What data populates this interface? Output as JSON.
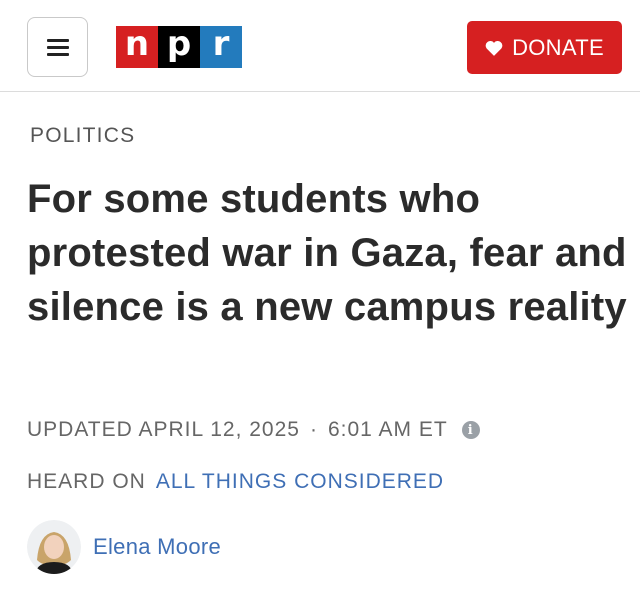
{
  "header": {
    "logo": [
      "n",
      "p",
      "r"
    ],
    "donate_label": "DONATE"
  },
  "article": {
    "section": "POLITICS",
    "headline": "For some students who protested war in Gaza, fear and silence is a new campus reality",
    "updated_label": "UPDATED APRIL 12, 2025",
    "separator": "·",
    "time": "6:01 AM ET",
    "info_symbol": "i",
    "heard_on_label": "HEARD ON",
    "show_name": "ALL THINGS CONSIDERED",
    "author": "Elena Moore"
  },
  "icons": {
    "menu": "hamburger-icon",
    "donate": "heart-icon",
    "info": "info-icon"
  },
  "colors": {
    "logo_n": "#d62021",
    "logo_p": "#000000",
    "logo_r": "#237bbd",
    "donate_bg": "#d62021",
    "link": "#3f6fb5"
  }
}
